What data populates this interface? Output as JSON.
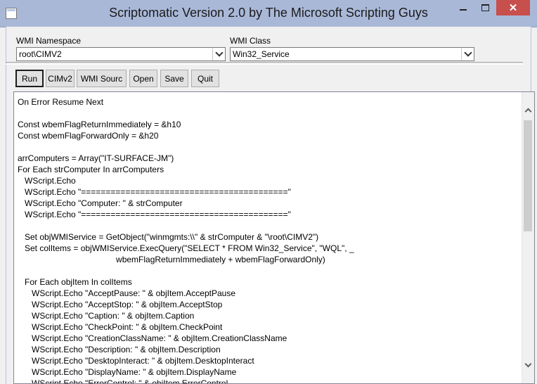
{
  "window": {
    "title": "Scriptomatic Version 2.0 by The Microsoft Scripting Guys",
    "close_glyph": "✕"
  },
  "namespace": {
    "label": "WMI Namespace",
    "value": "root\\CIMV2"
  },
  "wmi_class": {
    "label": "WMI Class",
    "value": "Win32_Service"
  },
  "toolbar": {
    "run": "Run",
    "cimv2": "CIMv2",
    "wmi_source": "WMI Sourc",
    "open": "Open",
    "save": "Save",
    "quit": "Quit"
  },
  "editor": {
    "lines": [
      "On Error Resume Next",
      "",
      "Const wbemFlagReturnImmediately = &h10",
      "Const wbemFlagForwardOnly = &h20",
      "",
      "arrComputers = Array(\"IT-SURFACE-JM\")",
      "For Each strComputer In arrComputers",
      "   WScript.Echo",
      "   WScript.Echo \"==========================================\"",
      "   WScript.Echo \"Computer: \" & strComputer",
      "   WScript.Echo \"==========================================\"",
      "",
      "   Set objWMIService = GetObject(\"winmgmts:\\\\\" & strComputer & \"\\root\\CIMV2\")",
      "   Set colItems = objWMIService.ExecQuery(\"SELECT * FROM Win32_Service\", \"WQL\", _",
      "                                          wbemFlagReturnImmediately + wbemFlagForwardOnly)",
      "",
      "   For Each objItem In colItems",
      "      WScript.Echo \"AcceptPause: \" & objItem.AcceptPause",
      "      WScript.Echo \"AcceptStop: \" & objItem.AcceptStop",
      "      WScript.Echo \"Caption: \" & objItem.Caption",
      "      WScript.Echo \"CheckPoint: \" & objItem.CheckPoint",
      "      WScript.Echo \"CreationClassName: \" & objItem.CreationClassName",
      "      WScript.Echo \"Description: \" & objItem.Description",
      "      WScript.Echo \"DesktopInteract: \" & objItem.DesktopInteract",
      "      WScript.Echo \"DisplayName: \" & objItem.DisplayName",
      "      WScript.Echo \"ErrorControl: \" & objItem.ErrorControl"
    ]
  },
  "icons": {
    "app": "app-icon",
    "minimize": "minimize-icon",
    "maximize": "maximize-icon",
    "close": "close-icon",
    "dropdown": "chevron-down-icon",
    "scroll_up": "chevron-up-icon",
    "scroll_down": "chevron-down-icon"
  },
  "colors": {
    "titlebar": "#aab8d8",
    "close_button": "#c74f4c",
    "editor_bg": "#ffffff"
  }
}
